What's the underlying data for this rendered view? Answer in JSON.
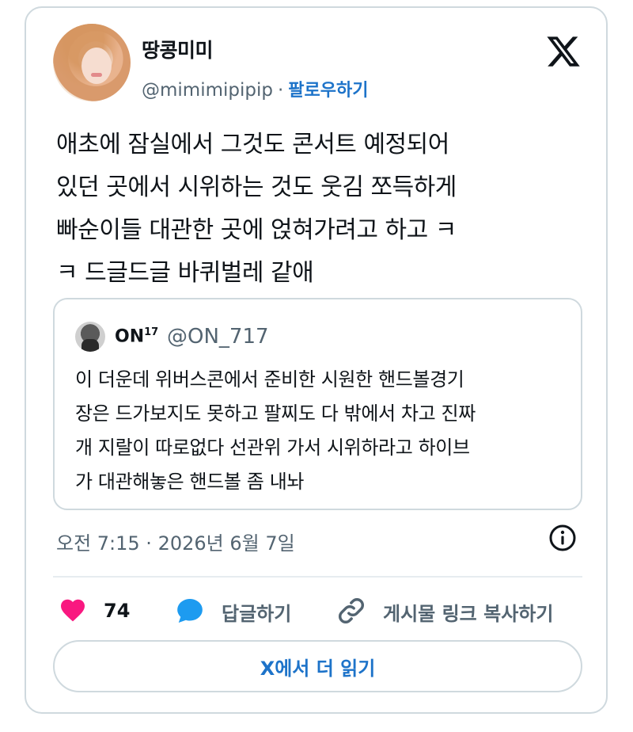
{
  "author": {
    "display_name": "땅콩미미",
    "handle": "@mimimipipip",
    "separator": "·",
    "follow_label": "팔로우하기"
  },
  "tweet": {
    "text": "애초에 잠실에서 그것도 콘서트 예정되어\n있던 곳에서 시위하는 것도 웃김 쪼득하게\n빠순이들 대관한 곳에 얹혀가려고 하고 ㅋ\nㅋ 드글드글 바퀴벌레 같애"
  },
  "quoted_tweet": {
    "display_name": "ON",
    "display_name_suffix": "17",
    "handle": "@ON_717",
    "text": "이 더운데 위버스콘에서 준비한 시원한 핸드볼경기\n장은 드가보지도 못하고 팔찌도 다 밖에서 차고 진짜\n개 지랄이 따로없다 선관위 가서 시위하라고 하이브\n가 대관해놓은 핸드볼 좀 내놔"
  },
  "timestamp": "오전 7:15 · 2026년 6월 7일",
  "actions": {
    "like_count": "74",
    "reply_label": "답글하기",
    "copy_link_label": "게시물 링크 복사하기"
  },
  "read_more_label": "X에서 더 읽기",
  "colors": {
    "accent": "#1d73c9",
    "heart": "#f91880",
    "reply": "#1d9bf0",
    "secondary_text": "#536471",
    "border": "#cfd9de"
  },
  "icons": [
    "x-logo-icon",
    "info-icon",
    "heart-icon",
    "reply-bubble-icon",
    "link-icon"
  ]
}
